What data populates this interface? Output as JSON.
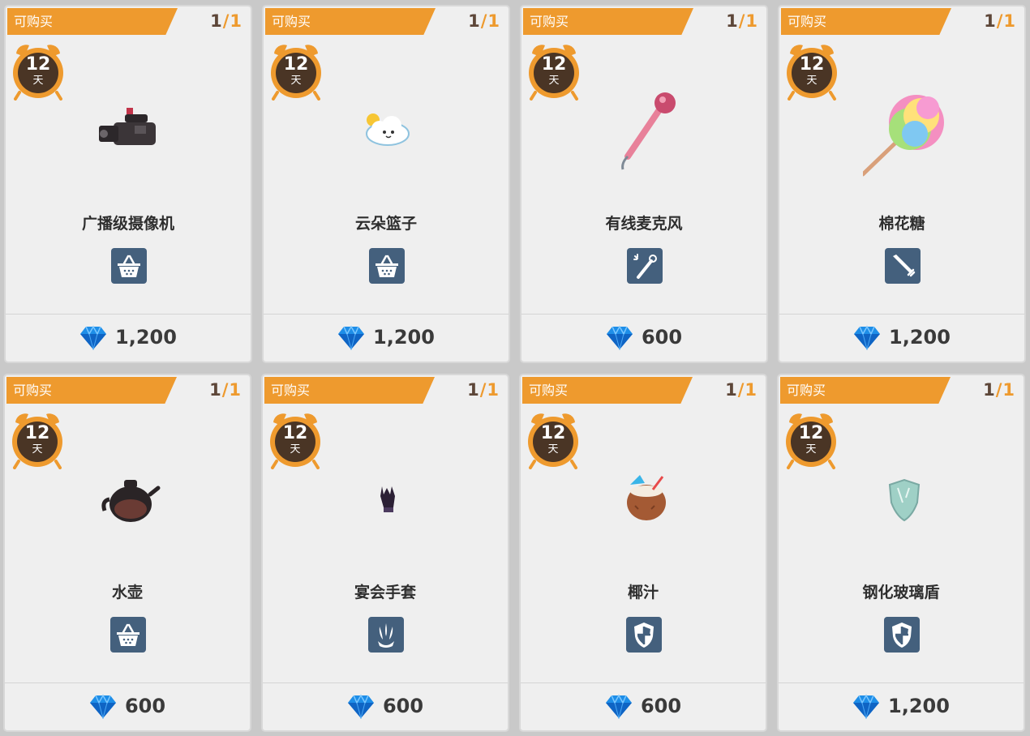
{
  "items": [
    {
      "status": "可购买",
      "stock_current": "1",
      "stock_sep": "/",
      "stock_max": "1",
      "timer_value": "12",
      "timer_unit": "天",
      "name": "广播级摄像机",
      "item_icon": "video-camera-icon",
      "category_icon": "basket-icon",
      "price": "1,200"
    },
    {
      "status": "可购买",
      "stock_current": "1",
      "stock_sep": "/",
      "stock_max": "1",
      "timer_value": "12",
      "timer_unit": "天",
      "name": "云朵篮子",
      "item_icon": "cloud-basket-icon",
      "category_icon": "basket-icon",
      "price": "1,200"
    },
    {
      "status": "可购买",
      "stock_current": "1",
      "stock_sep": "/",
      "stock_max": "1",
      "timer_value": "12",
      "timer_unit": "天",
      "name": "有线麦克风",
      "item_icon": "microphone-icon",
      "category_icon": "wand-icon",
      "price": "600"
    },
    {
      "status": "可购买",
      "stock_current": "1",
      "stock_sep": "/",
      "stock_max": "1",
      "timer_value": "12",
      "timer_unit": "天",
      "name": "棉花糖",
      "item_icon": "cotton-candy-icon",
      "category_icon": "sword-icon",
      "price": "1,200"
    },
    {
      "status": "可购买",
      "stock_current": "1",
      "stock_sep": "/",
      "stock_max": "1",
      "timer_value": "12",
      "timer_unit": "天",
      "name": "水壶",
      "item_icon": "kettle-icon",
      "category_icon": "basket-icon",
      "price": "600"
    },
    {
      "status": "可购买",
      "stock_current": "1",
      "stock_sep": "/",
      "stock_max": "1",
      "timer_value": "12",
      "timer_unit": "天",
      "name": "宴会手套",
      "item_icon": "glove-icon",
      "category_icon": "claw-icon",
      "price": "600"
    },
    {
      "status": "可购买",
      "stock_current": "1",
      "stock_sep": "/",
      "stock_max": "1",
      "timer_value": "12",
      "timer_unit": "天",
      "name": "椰汁",
      "item_icon": "coconut-drink-icon",
      "category_icon": "shield-icon",
      "price": "600"
    },
    {
      "status": "可购买",
      "stock_current": "1",
      "stock_sep": "/",
      "stock_max": "1",
      "timer_value": "12",
      "timer_unit": "天",
      "name": "钢化玻璃盾",
      "item_icon": "glass-shield-icon",
      "category_icon": "shield-icon",
      "price": "1,200"
    }
  ],
  "currency_icon": "diamond-icon",
  "colors": {
    "banner": "#ee9a2e",
    "category_bg": "#44607d",
    "timer_ring": "#ee9a2e",
    "timer_face": "#4a3525",
    "diamond": "#1e8ee8"
  }
}
